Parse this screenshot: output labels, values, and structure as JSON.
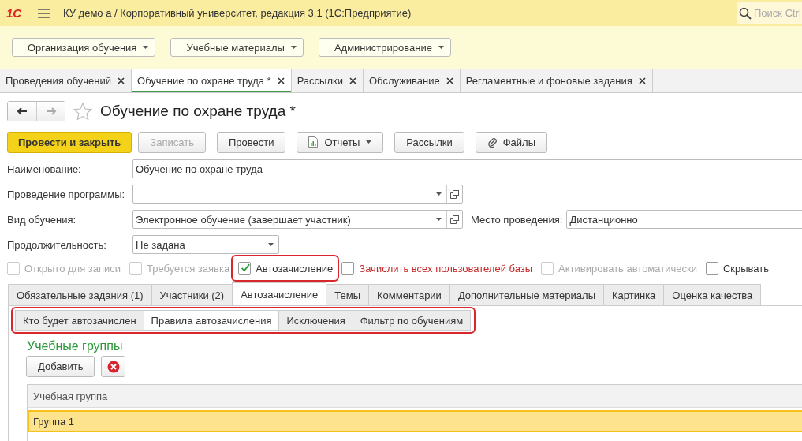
{
  "app": {
    "logo": "1С",
    "title": "КУ демо а / Корпоративный университет, редакция 3.1  (1С:Предприятие)",
    "search": {
      "placeholder": "Поиск Ctrl"
    }
  },
  "sections": [
    {
      "label": "Организация обучения"
    },
    {
      "label": "Учебные материалы"
    },
    {
      "label": "Администрирование"
    }
  ],
  "open_tabs": [
    {
      "label": "Проведения обучений",
      "selected": false
    },
    {
      "label": "Обучение по охране труда *",
      "selected": true
    },
    {
      "label": "Рассылки",
      "selected": false
    },
    {
      "label": "Обслуживание",
      "selected": false
    },
    {
      "label": "Регламентные и фоновые задания",
      "selected": false
    }
  ],
  "form": {
    "title": "Обучение по охране труда *",
    "toolbar": [
      {
        "label": "Провести и закрыть",
        "kind": "primary",
        "disabled": false
      },
      {
        "label": "Записать",
        "kind": "plain",
        "disabled": true
      },
      {
        "label": "Провести",
        "kind": "plain",
        "disabled": false
      },
      {
        "label": "Отчеты",
        "kind": "report",
        "disabled": false
      },
      {
        "label": "Рассылки",
        "kind": "plain",
        "disabled": false
      },
      {
        "label": "Файлы",
        "kind": "files",
        "disabled": false
      }
    ],
    "fields": [
      {
        "label": "Наименование:",
        "value": "Обучение по охране труда",
        "kind": "text"
      },
      {
        "label": "Проведение программы:",
        "kind": "choice"
      },
      {
        "label": "Вид обучения:",
        "value": "Электронное обучение (завершает участник)",
        "kind": "choice",
        "extra_label": "Место проведения:",
        "extra_value": "Дистанционно"
      },
      {
        "label": "Продолжительность:",
        "value": "Не задана",
        "kind": "short"
      }
    ],
    "checkboxes": [
      {
        "label": "Открыто для записи",
        "checked": false,
        "disabled": true,
        "warning": false,
        "annotated": false
      },
      {
        "label": "Требуется заявка",
        "checked": false,
        "disabled": true,
        "warning": false,
        "annotated": false
      },
      {
        "label": "Автозачисление",
        "checked": true,
        "disabled": false,
        "warning": false,
        "annotated": true
      },
      {
        "label": "Зачислить всех пользователей базы",
        "checked": false,
        "disabled": false,
        "warning": true,
        "annotated": false
      },
      {
        "label": "Активировать автоматически",
        "checked": false,
        "disabled": true,
        "warning": false,
        "annotated": false
      },
      {
        "label": "Скрывать",
        "checked": false,
        "disabled": false,
        "warning": false,
        "annotated": false
      }
    ],
    "tabs": [
      {
        "label": "Обязательные задания (1)",
        "selected": false
      },
      {
        "label": "Участники (2)",
        "selected": false
      },
      {
        "label": "Автозачисление",
        "selected": true
      },
      {
        "label": "Темы",
        "selected": false
      },
      {
        "label": "Комментарии",
        "selected": false
      },
      {
        "label": "Дополнительные материалы",
        "selected": false
      },
      {
        "label": "Картинка",
        "selected": false
      },
      {
        "label": "Оценка качества",
        "selected": false
      }
    ],
    "subtabs": {
      "annotated": true,
      "items": [
        {
          "label": "Кто будет автозачислен",
          "selected": false
        },
        {
          "label": "Правила автозачисления",
          "selected": true
        },
        {
          "label": "Исключения",
          "selected": false
        },
        {
          "label": "Фильтр по обучениям",
          "selected": false
        }
      ]
    },
    "group": {
      "title": "Учебные группы",
      "add_button": "Добавить",
      "table": {
        "columns": [
          "Учебная группа"
        ],
        "rows": [
          {
            "cells": [
              "Группа 1"
            ],
            "selected": true
          }
        ]
      }
    }
  }
}
